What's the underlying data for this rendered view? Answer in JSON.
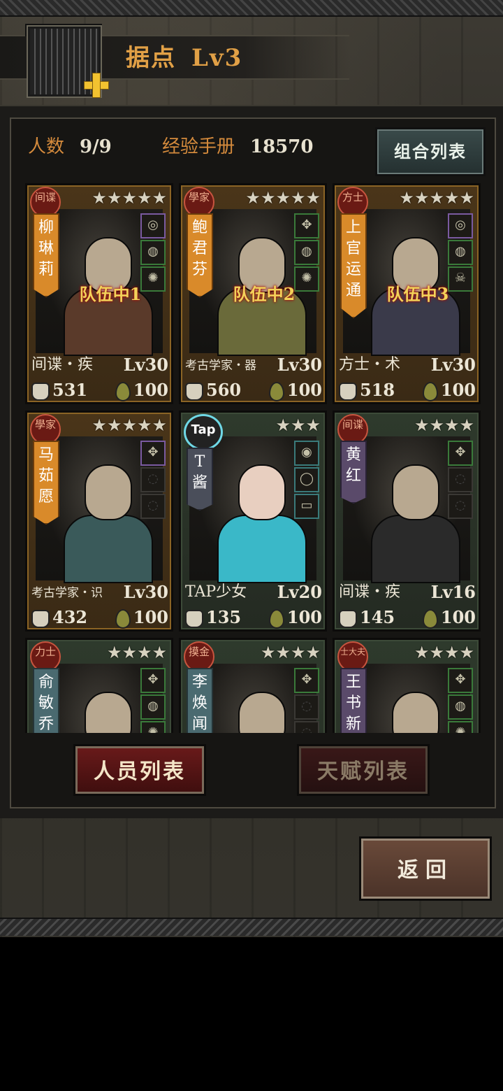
{
  "header": {
    "title": "据点",
    "level": "Lv3"
  },
  "stats": {
    "headcount_label": "人数",
    "headcount_value": "9/9",
    "manual_label": "经验手册",
    "manual_value": "18570"
  },
  "combo_button": "组合列表",
  "cards": [
    {
      "badge": "间谍",
      "stars": "★★★★★",
      "name": "柳琳莉",
      "team": "队伍中1",
      "class_label": "间谍・疾",
      "level": "Lv30",
      "power": "531",
      "hp": "100"
    },
    {
      "badge": "學家",
      "stars": "★★★★★",
      "name": "鲍君芬",
      "team": "队伍中2",
      "class_label": "考古学家・器",
      "level": "Lv30",
      "power": "560",
      "hp": "100"
    },
    {
      "badge": "方士",
      "stars": "★★★★★",
      "name": "上官运通",
      "team": "队伍中3",
      "class_label": "方士・术",
      "level": "Lv30",
      "power": "518",
      "hp": "100"
    },
    {
      "badge": "學家",
      "stars": "★★★★★",
      "name": "马茹愿",
      "team": "",
      "class_label": "考古学家・识",
      "level": "Lv30",
      "power": "432",
      "hp": "100"
    },
    {
      "badge": "Tap",
      "stars": "★★★",
      "name": "T酱",
      "team": "",
      "class_label": "TAP少女",
      "level": "Lv20",
      "power": "135",
      "hp": "100"
    },
    {
      "badge": "间谍",
      "stars": "★★★★",
      "name": "黄红",
      "team": "",
      "class_label": "间谍・疾",
      "level": "Lv16",
      "power": "145",
      "hp": "100"
    },
    {
      "badge": "力士",
      "stars": "★★★★",
      "name": "俞敏乔",
      "team": "",
      "class_label": "",
      "level": "",
      "power": "",
      "hp": ""
    },
    {
      "badge": "摸金",
      "stars": "★★★★",
      "name": "李焕闻",
      "team": "",
      "class_label": "",
      "level": "",
      "power": "",
      "hp": ""
    },
    {
      "badge": "士大夫",
      "stars": "★★★★",
      "name": "王书新",
      "team": "",
      "class_label": "",
      "level": "",
      "power": "",
      "hp": ""
    }
  ],
  "tabs": {
    "personnel": "人员列表",
    "talent": "天赋列表"
  },
  "back_button": "返回",
  "colors": {
    "accent": "#e1a046",
    "team_tag": "#f2d25a",
    "active_tab": "#6a1a1a"
  }
}
